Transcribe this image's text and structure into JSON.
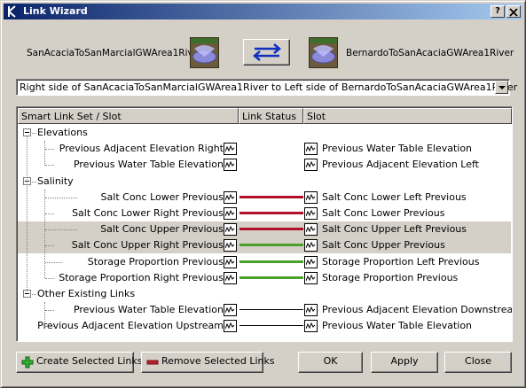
{
  "window": {
    "title": "Link Wizard",
    "help_label": "?",
    "close_label": "X"
  },
  "objects": {
    "left_name": "SanAcaciaToSanMarcialGWArea1River",
    "right_name": "BernardoToSanAcaciaGWArea1River"
  },
  "combo": {
    "value": "Right side of SanAcaciaToSanMarcialGWArea1River to Left side of BernardoToSanAcaciaGWArea1River"
  },
  "columns": [
    "Smart Link Set / Slot",
    "Link Status",
    "Slot"
  ],
  "groups": [
    {
      "label": "Elevations",
      "rows": [
        {
          "left": "Previous Adjacent Elevation Right",
          "right": "Previous Water Table Elevation",
          "status": "none",
          "selected": false
        },
        {
          "left": "Previous Water Table Elevation",
          "right": "Previous Adjacent Elevation Left",
          "status": "none",
          "selected": false
        }
      ]
    },
    {
      "label": "Salinity",
      "rows": [
        {
          "left": "Salt Conc Lower Previous",
          "right": "Salt Conc Lower Left Previous",
          "status": "remove",
          "selected": false
        },
        {
          "left": "Salt Conc Lower Right Previous",
          "right": "Salt Conc Lower Previous",
          "status": "remove",
          "selected": false
        },
        {
          "left": "Salt Conc Upper Previous",
          "right": "Salt Conc Upper Left Previous",
          "status": "remove",
          "selected": true
        },
        {
          "left": "Salt Conc Upper Right Previous",
          "right": "Salt Conc Upper Previous",
          "status": "create",
          "selected": true
        },
        {
          "left": "Storage Proportion Previous",
          "right": "Storage Proportion Left Previous",
          "status": "create",
          "selected": false
        },
        {
          "left": "Storage Proportion Right Previous",
          "right": "Storage Proportion Previous",
          "status": "create",
          "selected": false
        }
      ]
    },
    {
      "label": "Other Existing Links",
      "rows": [
        {
          "left": "Previous Water Table Elevation",
          "right": "Previous Adjacent Elevation Downstream",
          "status": "existing",
          "selected": false
        },
        {
          "left": "Previous Adjacent Elevation Upstream",
          "right": "Previous Water Table Elevation",
          "status": "existing",
          "selected": false
        }
      ]
    }
  ],
  "status_colors": {
    "remove": "#b0102a",
    "create": "#4aa02a",
    "existing": "#000000",
    "selected_row": "#d4d0c8"
  },
  "buttons": {
    "create": "Create Selected Links",
    "remove": "Remove Selected Links",
    "ok": "OK",
    "apply": "Apply",
    "close": "Close"
  }
}
